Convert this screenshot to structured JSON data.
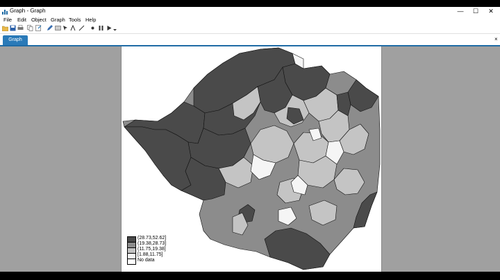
{
  "window": {
    "title": "Graph - Graph",
    "minimize": "—",
    "maximize": "☐",
    "close": "✕"
  },
  "menu": [
    "File",
    "Edit",
    "Object",
    "Graph",
    "Tools",
    "Help"
  ],
  "toolbar": {
    "icons": [
      "open-icon",
      "save-icon",
      "print-icon",
      "copy-icon",
      "export-icon",
      "edit-icon",
      "recorder-icon",
      "pointer-icon",
      "add-text-icon",
      "add-line-icon",
      "marker-icon",
      "pause-icon",
      "play-icon",
      "dropdown-icon"
    ]
  },
  "tab": {
    "label": "Graph",
    "close": "×"
  },
  "legend": {
    "entries": [
      {
        "label": "(28.73,52.62]",
        "color": "#4a4a4a"
      },
      {
        "label": "(19.38,28.73]",
        "color": "#8c8c8c"
      },
      {
        "label": "(11.75,19.38]",
        "color": "#c4c4c4"
      },
      {
        "label": "[1.88,11.75]",
        "color": "#f5f5f5"
      },
      {
        "label": "No data",
        "color": "#ffffff"
      }
    ]
  },
  "colors": {
    "dark": "#4a4a4a",
    "mid": "#8c8c8c",
    "light": "#c4c4c4",
    "white": "#f5f5f5",
    "accent": "#2a7ab8"
  }
}
